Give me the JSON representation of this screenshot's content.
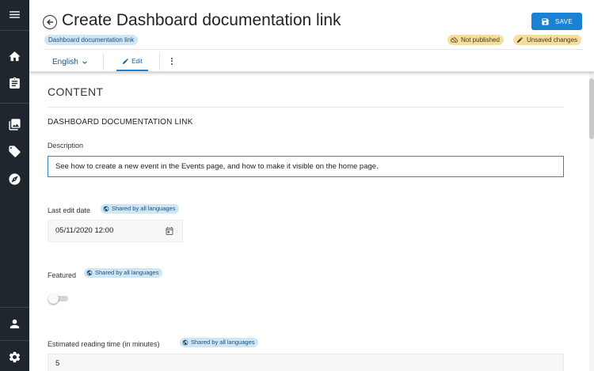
{
  "sidebar": {
    "icons": [
      "menu-icon",
      "home-icon",
      "clipboard-icon",
      "images-icon",
      "tag-icon",
      "compass-icon",
      "user-icon",
      "gear-icon"
    ]
  },
  "header": {
    "title": "Create Dashboard documentation link",
    "slug_badge": "Dashboard documentation link",
    "save_label": "SAVE",
    "badges": {
      "not_published": "Not published",
      "unsaved": "Unsaved changes"
    },
    "language": "English",
    "edit_tab": "Edit"
  },
  "content": {
    "section_title": "CONTENT",
    "subsection_title": "DASHBOARD DOCUMENTATION LINK",
    "description": {
      "label": "Description",
      "value": "See how to create a new event in the Events page, and how to make it visible on the home page."
    },
    "last_edit_date": {
      "label": "Last edit date",
      "shared": "Shared by all languages",
      "value": "05/11/2020 12:00"
    },
    "featured": {
      "label": "Featured",
      "shared": "Shared by all languages",
      "value": false
    },
    "reading_time": {
      "label": "Estimated reading time (in minutes)",
      "shared": "Shared by all languages",
      "value": "5"
    }
  },
  "colors": {
    "sidebar_bg": "#1f262e",
    "accent": "#1a82d4",
    "status_badge_bg": "#f5dda0",
    "info_badge_bg": "#cfe6f5"
  }
}
